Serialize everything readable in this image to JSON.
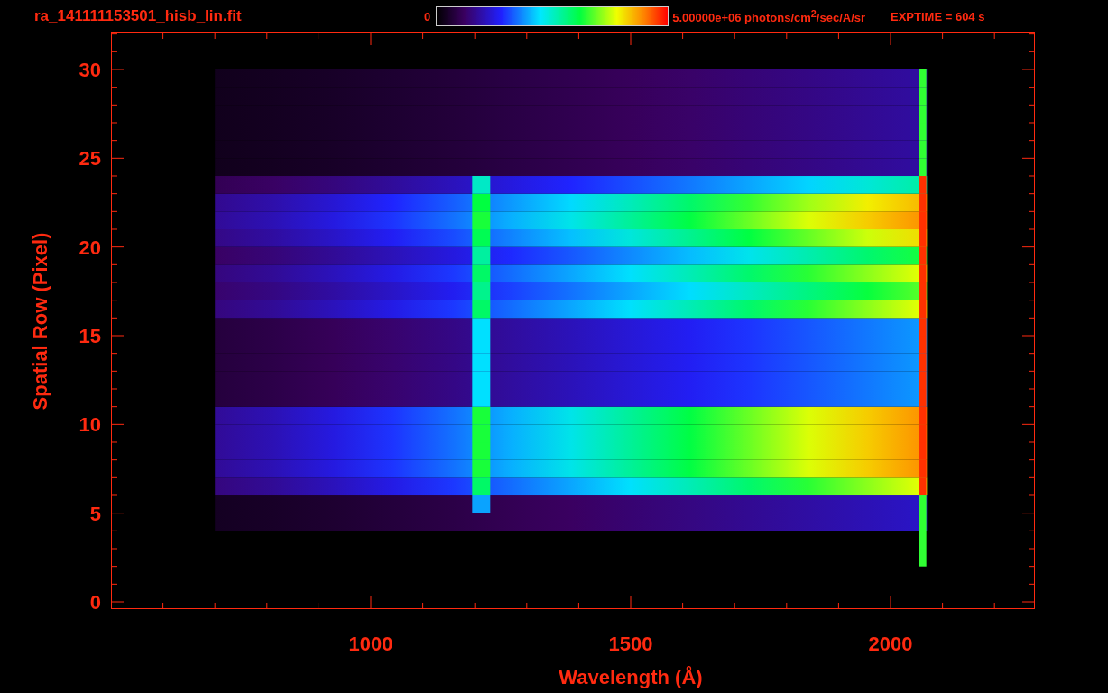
{
  "title": "ra_141111153501_hisb_lin.fit",
  "colorbar": {
    "min_label": "0",
    "max_label": "5.00000e+06 photons/cm$^{2}$/sec/A/sr"
  },
  "exposure": "EXPTIME = 604 s",
  "y_axis": {
    "title": "Spatial Row (Pixel)",
    "ticks": [
      "30",
      "25",
      "20",
      "15",
      "10",
      "5",
      "0"
    ]
  },
  "x_axis": {
    "title": "Wavelength (Å)",
    "ticks": [
      "1000",
      "1500",
      "2000"
    ]
  }
}
